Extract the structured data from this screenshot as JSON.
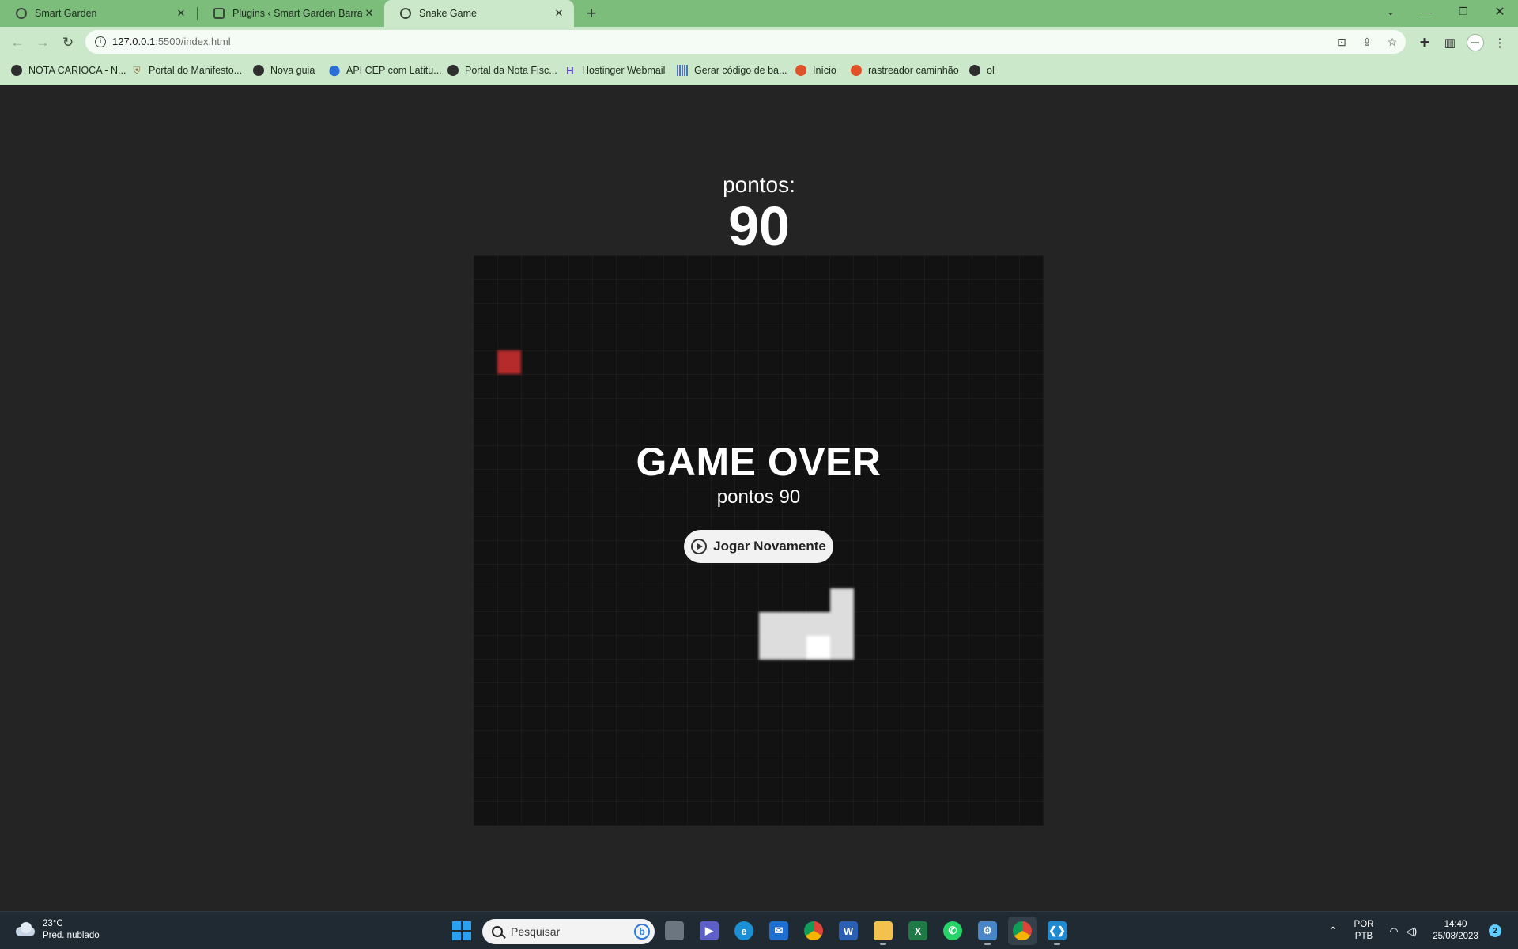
{
  "browser": {
    "tabs": [
      {
        "title": "Smart Garden",
        "active": false
      },
      {
        "title": "Plugins ‹ Smart Garden Barra – Lo",
        "active": false
      },
      {
        "title": "Snake Game",
        "active": true
      }
    ],
    "address": {
      "host": "127.0.0.1",
      "rest": ":5500/index.html"
    },
    "bookmarks": [
      {
        "label": "NOTA CARIOCA - N...",
        "icon": "globe-icon"
      },
      {
        "label": "Portal do Manifesto...",
        "icon": "shield-icon"
      },
      {
        "label": "Nova guia",
        "icon": "globe-icon"
      },
      {
        "label": "API CEP com Latitu...",
        "icon": "pin-icon"
      },
      {
        "label": "Portal da Nota Fisc...",
        "icon": "globe-icon"
      },
      {
        "label": "Hostinger Webmail",
        "icon": "hostinger-icon"
      },
      {
        "label": "Gerar código de ba...",
        "icon": "barcode-icon"
      },
      {
        "label": "Início",
        "icon": "tracker-icon"
      },
      {
        "label": "rastreador caminhão",
        "icon": "tracker-icon"
      },
      {
        "label": "ol",
        "icon": "globe-icon"
      }
    ]
  },
  "game": {
    "score_label": "pontos:",
    "score": "90",
    "game_over_title": "GAME OVER",
    "final_score_text": "pontos 90",
    "replay_label": "Jogar Novamente",
    "colors": {
      "board": "#121212",
      "food": "#b52b2b",
      "snake": "#dddddd",
      "snake_head": "#ffffff",
      "page": "#242424"
    },
    "grid_cells": 24,
    "food_cell": [
      1,
      4
    ],
    "snake_cells": [
      [
        15,
        16
      ],
      [
        14,
        16
      ],
      [
        13,
        15
      ],
      [
        12,
        15
      ],
      [
        13,
        16
      ],
      [
        14,
        15
      ],
      [
        15,
        15
      ],
      [
        12,
        16
      ],
      [
        15,
        14
      ]
    ],
    "snake_head_cell": [
      14,
      16
    ]
  },
  "taskbar": {
    "weather_temp": "23°C",
    "weather_desc": "Pred. nublado",
    "search_placeholder": "Pesquisar",
    "language_line1": "POR",
    "language_line2": "PTB",
    "time": "14:40",
    "date": "25/08/2023",
    "notification_count": "2"
  }
}
